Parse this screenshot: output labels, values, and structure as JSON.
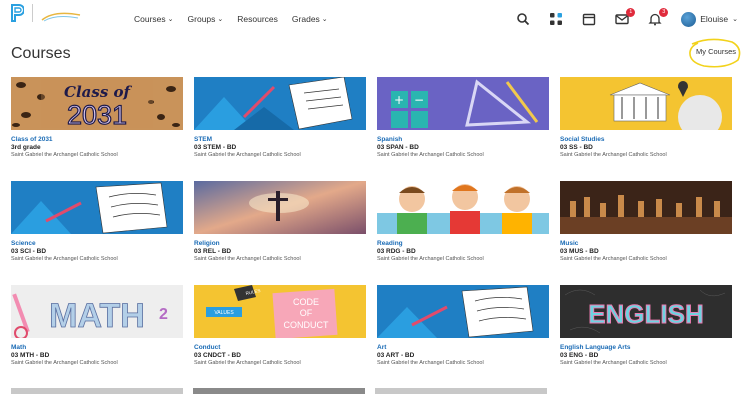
{
  "nav": {
    "links": [
      {
        "label": "Courses",
        "has_menu": true
      },
      {
        "label": "Groups",
        "has_menu": true
      },
      {
        "label": "Resources",
        "has_menu": false
      },
      {
        "label": "Grades",
        "has_menu": true
      }
    ],
    "caret": "⌄",
    "icons": [
      "search-icon",
      "apps-grid-icon",
      "calendar-icon",
      "mail-icon",
      "bell-icon"
    ],
    "badges": {
      "mail": "1",
      "notifications": "3"
    },
    "user_name": "Elouise"
  },
  "page": {
    "title": "Courses",
    "my_courses_label": "My Courses"
  },
  "courses": [
    {
      "title": "Class of 2031",
      "code": "3rd grade",
      "school": "Saint Gabriel the Archangel Catholic School",
      "thumb_text": [
        "Class of",
        "2031"
      ]
    },
    {
      "title": "STEM",
      "code": "03 STEM - BD",
      "school": "Saint Gabriel the Archangel Catholic School"
    },
    {
      "title": "Spanish",
      "code": "03 SPAN - BD",
      "school": "Saint Gabriel the Archangel Catholic School"
    },
    {
      "title": "Social Studies",
      "code": "03 SS - BD",
      "school": "Saint Gabriel the Archangel Catholic School"
    },
    {
      "title": "Science",
      "code": "03 SCI - BD",
      "school": "Saint Gabriel the Archangel Catholic School"
    },
    {
      "title": "Religion",
      "code": "03 REL - BD",
      "school": "Saint Gabriel the Archangel Catholic School"
    },
    {
      "title": "Reading",
      "code": "03 RDG - BD",
      "school": "Saint Gabriel the Archangel Catholic School"
    },
    {
      "title": "Music",
      "code": "03 MUS - BD",
      "school": "Saint Gabriel the Archangel Catholic School"
    },
    {
      "title": "Math",
      "code": "03 MTH - BD",
      "school": "Saint Gabriel the Archangel Catholic School",
      "thumb_text": [
        "MATH",
        "2"
      ]
    },
    {
      "title": "Conduct",
      "code": "03 CNDCT - BD",
      "school": "Saint Gabriel the Archangel Catholic School",
      "thumb_text": [
        "RULES",
        "VALUES",
        "CODE",
        "OF",
        "CONDUCT"
      ]
    },
    {
      "title": "Art",
      "code": "03 ART - BD",
      "school": "Saint Gabriel the Archangel Catholic School"
    },
    {
      "title": "English Language Arts",
      "code": "03 ENG - BD",
      "school": "Saint Gabriel the Archangel Catholic School",
      "thumb_text": [
        "ENGLISH"
      ]
    }
  ],
  "colors": {
    "link_blue": "#1a6bb5",
    "brand_blue": "#2aa0e0",
    "badge_red": "#e02b3c",
    "highlight_yellow": "#f2d21b"
  }
}
